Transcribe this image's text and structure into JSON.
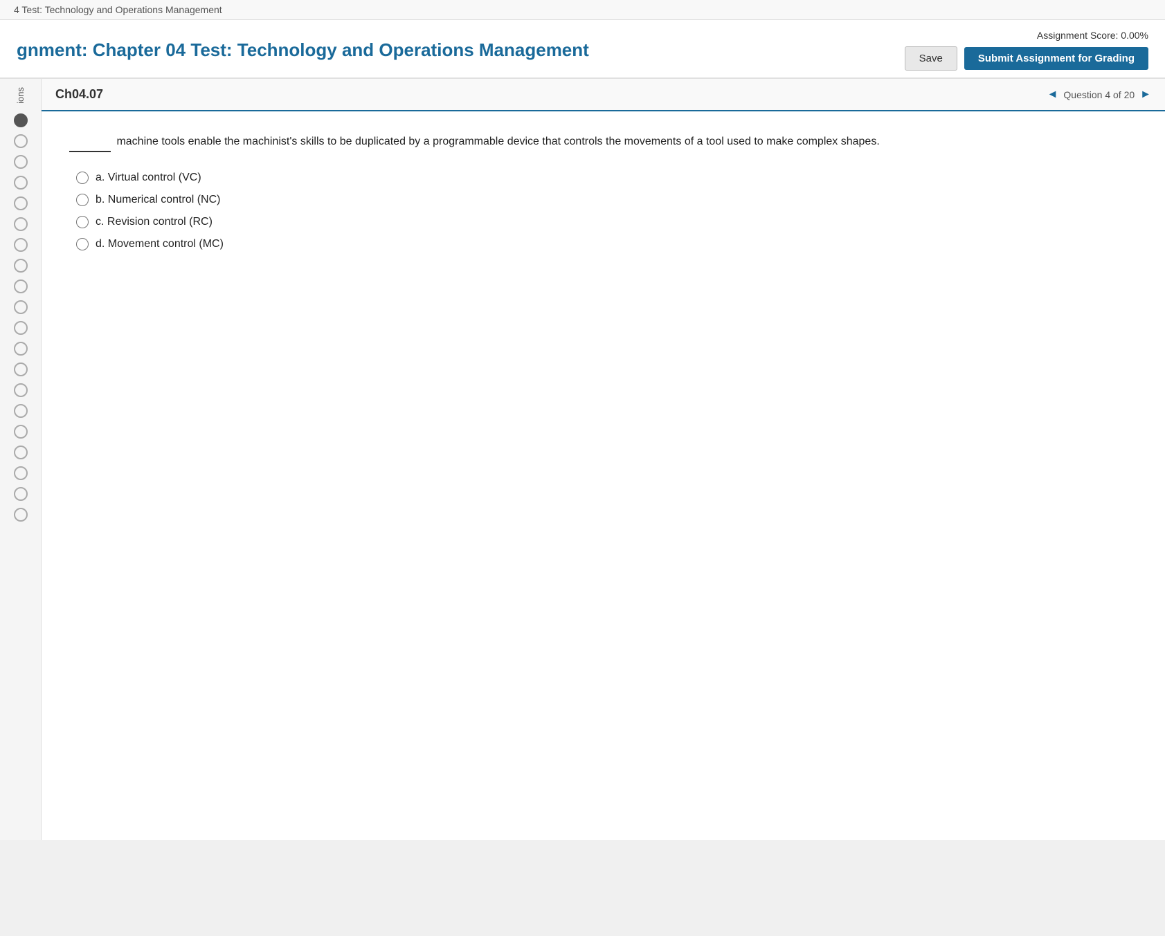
{
  "topbar": {
    "title": "4 Test: Technology and Operations Management"
  },
  "header": {
    "assignment_title": "gnment: Chapter 04 Test: Technology and Operations Management",
    "score_label": "Assignment Score: 0.00%",
    "save_button": "Save",
    "submit_button": "Submit Assignment for Grading"
  },
  "sidebar": {
    "label": "ions"
  },
  "question": {
    "chapter_code": "Ch04.07",
    "nav_text": "Question 4 of 20",
    "nav_prev": "◄",
    "nav_next": "►",
    "text_part1": "machine tools enable the machinist's skills to be duplicated by a programmable device that controls the movements of a tool used to make complex shapes.",
    "options": [
      {
        "id": "a",
        "label": "a. Virtual control (VC)"
      },
      {
        "id": "b",
        "label": "b. Numerical control (NC)"
      },
      {
        "id": "c",
        "label": "c. Revision control (RC)"
      },
      {
        "id": "d",
        "label": "d. Movement control (MC)"
      }
    ]
  },
  "sidebar_dots": [
    "filled",
    "empty",
    "empty",
    "empty",
    "empty",
    "empty",
    "empty",
    "empty",
    "empty",
    "empty",
    "empty",
    "empty",
    "empty",
    "empty",
    "empty",
    "empty",
    "empty",
    "empty",
    "empty",
    "empty"
  ]
}
